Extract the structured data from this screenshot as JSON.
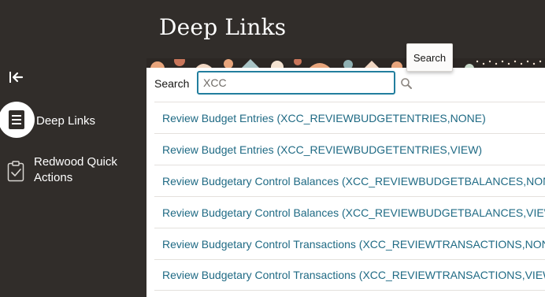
{
  "page": {
    "title": "Deep Links"
  },
  "sidebar": {
    "collapse_icon": "collapse-left-icon",
    "items": [
      {
        "label": "Deep Links",
        "icon": "document-list-icon",
        "selected": true
      },
      {
        "label": "Redwood Quick Actions",
        "icon": "clipboard-check-icon",
        "selected": false
      }
    ]
  },
  "search": {
    "label": "Search",
    "value": "XCC",
    "button_icon": "search-icon",
    "tooltip": "Search"
  },
  "results": [
    "Review Budget Entries (XCC_REVIEWBUDGETENTRIES,NONE)",
    "Review Budget Entries (XCC_REVIEWBUDGETENTRIES,VIEW)",
    "Review Budgetary Control Balances (XCC_REVIEWBUDGETBALANCES,NONE)",
    "Review Budgetary Control Balances (XCC_REVIEWBUDGETBALANCES,VIEW)",
    "Review Budgetary Control Transactions (XCC_REVIEWTRANSACTIONS,NONE)",
    "Review Budgetary Control Transactions (XCC_REVIEWTRANSACTIONS,VIEW)"
  ],
  "colors": {
    "background": "#312d2a",
    "link": "#1f6a84",
    "focus_border": "#227e9e",
    "banner_accent": "#e8a57c"
  }
}
